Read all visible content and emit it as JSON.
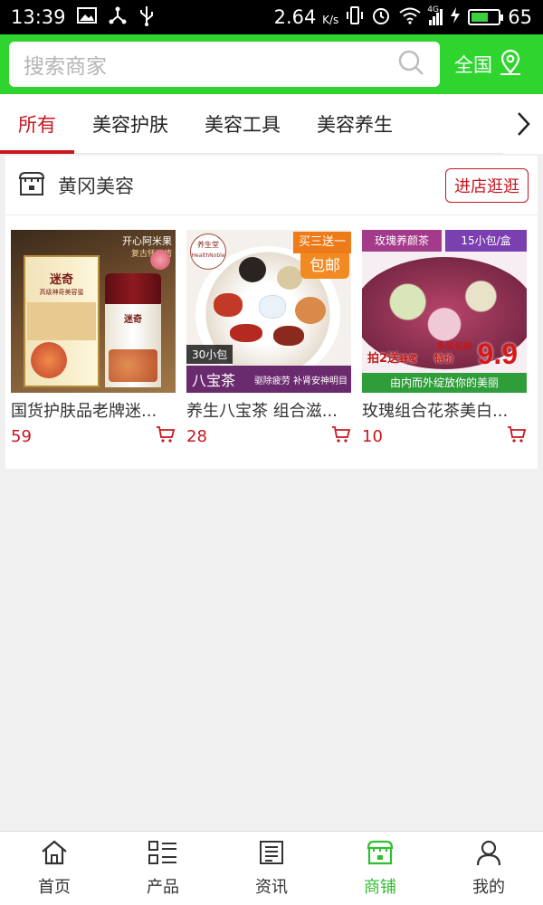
{
  "status_bar": {
    "time": "13:39",
    "speed": "2.64",
    "speed_unit": "K/s",
    "battery": "65",
    "network": "4G",
    "battery_level": 0.65,
    "icons": [
      "image-icon",
      "share-icon",
      "usb-icon",
      "vibrate-icon",
      "alarm-icon",
      "wifi-icon",
      "signal-icon",
      "charging-icon",
      "battery-icon"
    ]
  },
  "header": {
    "search_placeholder": "搜索商家",
    "region_label": "全国",
    "accent_color": "#2fd42f"
  },
  "tabs": {
    "items": [
      "所有",
      "美容护肤",
      "美容工具",
      "美容养生"
    ],
    "active_index": 0,
    "active_color": "#c7161e"
  },
  "shop": {
    "name": "黄冈美容",
    "visit_button": "进店逛逛",
    "products": [
      {
        "title": "国货护肤品老牌迷...",
        "price": "59",
        "image": {
          "badge": "开心阿米果",
          "subbadge": "复古怀旧情",
          "box_label": "迷奇",
          "box_sub": "高级神奇美容蜜",
          "jar_label": "迷奇"
        }
      },
      {
        "title": "养生八宝茶 组合滋...",
        "price": "28",
        "image": {
          "promo_top": "买三送一",
          "promo_bottom": "包邮",
          "logo_cn": "养生堂",
          "logo_en": "HealthNoble",
          "count": "30小包",
          "name": "八宝茶",
          "effect": "驱除疲劳 补肾安神明目"
        }
      },
      {
        "title": "玫瑰组合花茶美白...",
        "price": "10",
        "image": {
          "name": "玫瑰养颜茶",
          "pack": "15小包/盒",
          "promo": "拍2送",
          "gift": "蜂蜜",
          "price_label": "特价",
          "big_price": "9.9",
          "slogan": "由内而外绽放你的美丽",
          "tag": "多买包邮"
        }
      }
    ]
  },
  "bottom_nav": {
    "items": [
      {
        "label": "首页",
        "icon": "home-icon"
      },
      {
        "label": "产品",
        "icon": "list-icon"
      },
      {
        "label": "资讯",
        "icon": "news-icon"
      },
      {
        "label": "商铺",
        "icon": "store-icon"
      },
      {
        "label": "我的",
        "icon": "user-icon"
      }
    ],
    "active_index": 3,
    "active_color": "#2fbf2f"
  }
}
